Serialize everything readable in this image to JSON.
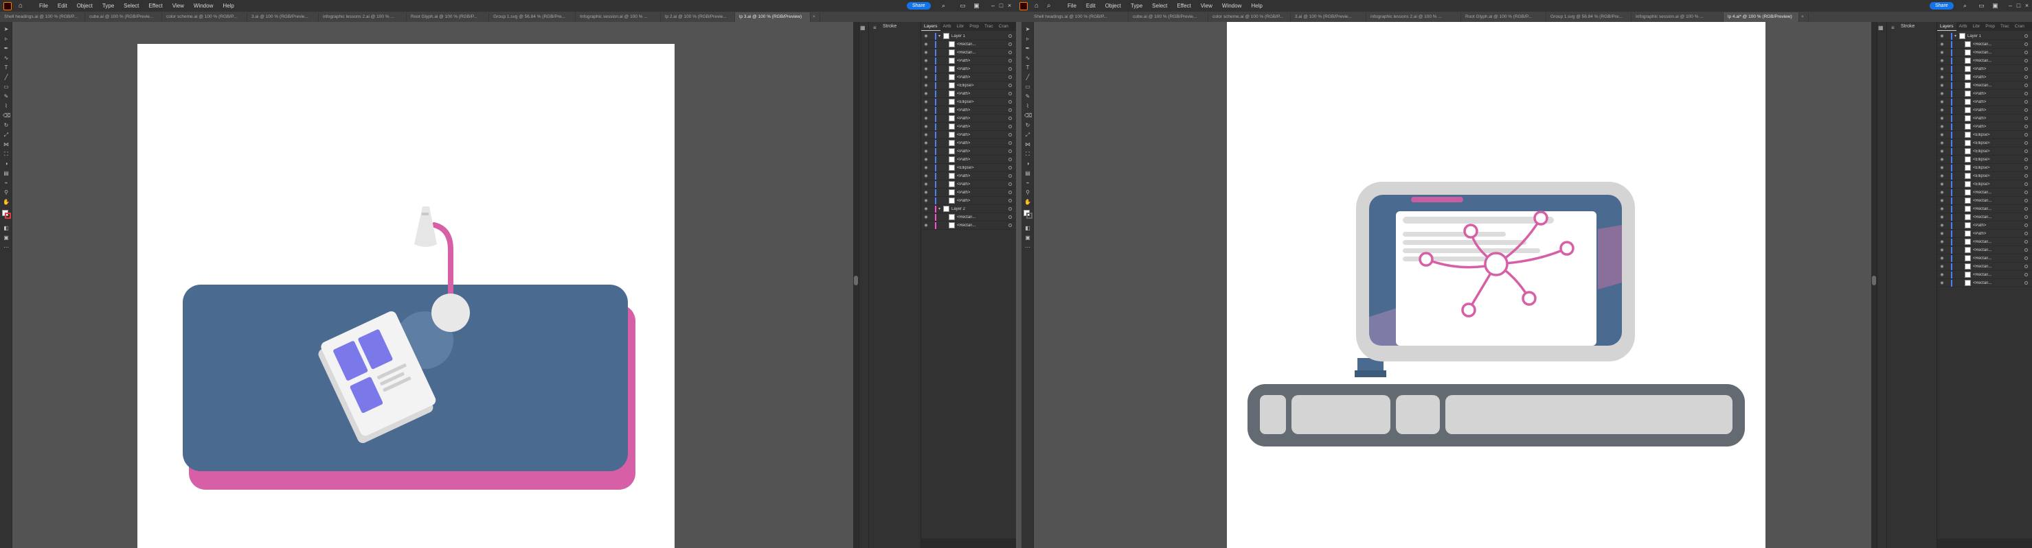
{
  "left": {
    "menu": [
      "File",
      "Edit",
      "Object",
      "Type",
      "Select",
      "Effect",
      "View",
      "Window",
      "Help"
    ],
    "share_label": "Share",
    "tabs": [
      {
        "label": "Shell headings.ai @ 100 % (RGB/P...",
        "active": false
      },
      {
        "label": "cube.ai @ 100 % (RGB/Previe...",
        "active": false
      },
      {
        "label": "color scheme.ai @ 100 % (RGB/P...",
        "active": false
      },
      {
        "label": "3.ai @ 100 % (RGB/Previe...",
        "active": false
      },
      {
        "label": "infographic lessons 2.ai @ 100 % ...",
        "active": false
      },
      {
        "label": "Root Glyph.ai @ 100 % (RGB/P...",
        "active": false
      },
      {
        "label": "Group 1.svg @ 56.84 % (RGB/Pre...",
        "active": false
      },
      {
        "label": "Infographic session.ai @ 100 % ...",
        "active": false
      },
      {
        "label": "lp 2.ai @ 100 % (RGB/Previe...",
        "active": false
      },
      {
        "label": "lp 3.ai @ 100 % (RGB/Preview)",
        "active": true
      }
    ],
    "properties_label": "Stroke",
    "panel_tabs": [
      "Layers",
      "Artb",
      "Libr",
      "Prop",
      "Trac",
      "Cran"
    ],
    "layers": [
      {
        "name": "Layer 1",
        "group": true,
        "color": "#4f7dff"
      },
      {
        "name": "<Rectan...",
        "color": "#4f7dff"
      },
      {
        "name": "<Rectan...",
        "color": "#4f7dff"
      },
      {
        "name": "<Path>",
        "color": "#4f7dff"
      },
      {
        "name": "<Path>",
        "color": "#4f7dff"
      },
      {
        "name": "<Path>",
        "color": "#4f7dff"
      },
      {
        "name": "<Ellipse>",
        "color": "#4f7dff"
      },
      {
        "name": "<Path>",
        "color": "#4f7dff"
      },
      {
        "name": "<Ellipse>",
        "color": "#4f7dff"
      },
      {
        "name": "<Path>",
        "color": "#4f7dff"
      },
      {
        "name": "<Path>",
        "color": "#4f7dff"
      },
      {
        "name": "<Path>",
        "color": "#4f7dff"
      },
      {
        "name": "<Path>",
        "color": "#4f7dff"
      },
      {
        "name": "<Path>",
        "color": "#4f7dff"
      },
      {
        "name": "<Path>",
        "color": "#4f7dff"
      },
      {
        "name": "<Path>",
        "color": "#4f7dff"
      },
      {
        "name": "<Ellipse>",
        "color": "#4f7dff"
      },
      {
        "name": "<Path>",
        "color": "#4f7dff"
      },
      {
        "name": "<Path>",
        "color": "#4f7dff"
      },
      {
        "name": "<Path>",
        "color": "#4f7dff"
      },
      {
        "name": "<Path>",
        "color": "#4f7dff"
      },
      {
        "name": "Layer 2",
        "group": true,
        "color": "#ff4fd8"
      },
      {
        "name": "<Rectan...",
        "color": "#ff4fd8"
      },
      {
        "name": "<Rectan...",
        "color": "#ff4fd8"
      }
    ]
  },
  "right": {
    "menu": [
      "File",
      "Edit",
      "Object",
      "Type",
      "Select",
      "Effect",
      "View",
      "Window",
      "Help"
    ],
    "share_label": "Share",
    "tabs": [
      {
        "label": "Shell headings.ai @ 100 % (RGB/P...",
        "active": false
      },
      {
        "label": "cube.ai @ 100 % (RGB/Previe...",
        "active": false
      },
      {
        "label": "color scheme.ai @ 100 % (RGB/P...",
        "active": false
      },
      {
        "label": "3.ai @ 100 % (RGB/Previe...",
        "active": false
      },
      {
        "label": "infographic lessons 2.ai @ 100 % ...",
        "active": false
      },
      {
        "label": "Root Glyph.ai @ 100 % (RGB/P...",
        "active": false
      },
      {
        "label": "Group 1.svg @ 56.84 % (RGB/Pre...",
        "active": false
      },
      {
        "label": "Infographic session.ai @ 100 % ...",
        "active": false
      },
      {
        "label": "lp 4.ai* @ 100 % (RGB/Preview)",
        "active": true
      }
    ],
    "properties_label": "Stroke",
    "panel_tabs": [
      "Layers",
      "Artb",
      "Libr",
      "Prop",
      "Trac",
      "Cran"
    ],
    "layers": [
      {
        "name": "Layer 1",
        "group": true,
        "color": "#4f7dff"
      },
      {
        "name": "<Rectan...",
        "color": "#4f7dff"
      },
      {
        "name": "<Rectan...",
        "color": "#4f7dff"
      },
      {
        "name": "<Rectan...",
        "color": "#4f7dff"
      },
      {
        "name": "<Path>",
        "color": "#4f7dff"
      },
      {
        "name": "<Path>",
        "color": "#4f7dff"
      },
      {
        "name": "<Rectan...",
        "color": "#4f7dff"
      },
      {
        "name": "<Path>",
        "color": "#4f7dff"
      },
      {
        "name": "<Path>",
        "color": "#4f7dff"
      },
      {
        "name": "<Path>",
        "color": "#4f7dff"
      },
      {
        "name": "<Path>",
        "color": "#4f7dff"
      },
      {
        "name": "<Path>",
        "color": "#4f7dff"
      },
      {
        "name": "<Ellipse>",
        "color": "#4f7dff"
      },
      {
        "name": "<Ellipse>",
        "color": "#4f7dff"
      },
      {
        "name": "<Ellipse>",
        "color": "#4f7dff"
      },
      {
        "name": "<Ellipse>",
        "color": "#4f7dff"
      },
      {
        "name": "<Ellipse>",
        "color": "#4f7dff"
      },
      {
        "name": "<Ellipse>",
        "color": "#4f7dff"
      },
      {
        "name": "<Ellipse>",
        "color": "#4f7dff"
      },
      {
        "name": "<Rectan...",
        "color": "#4f7dff"
      },
      {
        "name": "<Rectan...",
        "color": "#4f7dff"
      },
      {
        "name": "<Rectan...",
        "color": "#4f7dff"
      },
      {
        "name": "<Rectan...",
        "color": "#4f7dff"
      },
      {
        "name": "<Path>",
        "color": "#4f7dff"
      },
      {
        "name": "<Path>",
        "color": "#4f7dff"
      },
      {
        "name": "<Rectan...",
        "color": "#4f7dff"
      },
      {
        "name": "<Rectan...",
        "color": "#4f7dff"
      },
      {
        "name": "<Rectan...",
        "color": "#4f7dff"
      },
      {
        "name": "<Rectan...",
        "color": "#4f7dff"
      },
      {
        "name": "<Rectan...",
        "color": "#4f7dff"
      },
      {
        "name": "<Rectan...",
        "color": "#4f7dff"
      }
    ]
  },
  "colors": {
    "brand_blue": "#4a6b8f",
    "pink": "#d65fa6",
    "violet": "#7b78ea",
    "gray": "#d4d4d4",
    "dark_gray": "#646a72"
  }
}
